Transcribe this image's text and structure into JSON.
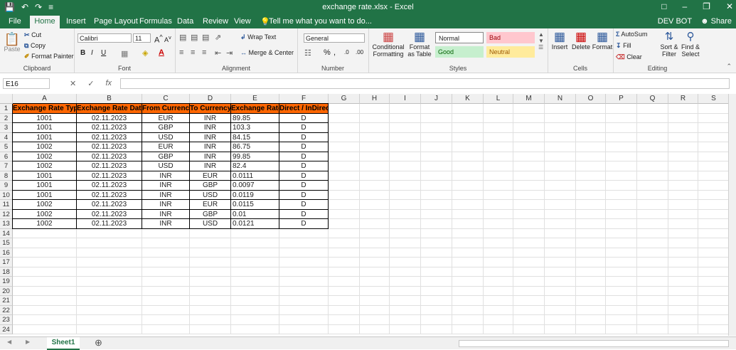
{
  "window": {
    "title": "exchange rate.xlsx - Excel",
    "user": "DEV BOT",
    "share": "Share"
  },
  "tabs": [
    "File",
    "Home",
    "Insert",
    "Page Layout",
    "Formulas",
    "Data",
    "Review",
    "View"
  ],
  "tell_me": "Tell me what you want to do...",
  "ribbon": {
    "clipboard": {
      "label": "Clipboard",
      "paste": "Paste",
      "cut": "Cut",
      "copy": "Copy",
      "format_painter": "Format Painter"
    },
    "font": {
      "label": "Font",
      "name": "Calibri",
      "size": "11"
    },
    "alignment": {
      "label": "Alignment",
      "wrap": "Wrap Text",
      "merge": "Merge & Center"
    },
    "number": {
      "label": "Number",
      "format": "General"
    },
    "styles": {
      "label": "Styles",
      "conditional": "Conditional Formatting",
      "format_as_table": "Format as Table",
      "normal": "Normal",
      "bad": "Bad",
      "good": "Good",
      "neutral": "Neutral"
    },
    "cells": {
      "label": "Cells",
      "insert": "Insert",
      "delete": "Delete",
      "format": "Format"
    },
    "editing": {
      "label": "Editing",
      "autosum": "AutoSum",
      "fill": "Fill",
      "clear": "Clear",
      "sort": "Sort & Filter",
      "find": "Find & Select"
    }
  },
  "formula_bar": {
    "name_box": "E16",
    "content": ""
  },
  "columns": [
    "A",
    "B",
    "C",
    "D",
    "E",
    "F",
    "G",
    "H",
    "I",
    "J",
    "K",
    "L",
    "M",
    "N",
    "O",
    "P",
    "Q",
    "R",
    "S"
  ],
  "rows": [
    "1",
    "2",
    "3",
    "4",
    "5",
    "6",
    "7",
    "8",
    "9",
    "10",
    "11",
    "12",
    "13",
    "14",
    "15",
    "16",
    "17",
    "18",
    "19",
    "20",
    "21",
    "22",
    "23",
    "24"
  ],
  "table": {
    "headers": [
      "Exchange Rate Type",
      "Exchange Rate Date",
      "From Currency",
      "To Currency",
      "Exchange Rate",
      "Direct / InDirect"
    ],
    "rows": [
      [
        "1001",
        "02.11.2023",
        "EUR",
        "INR",
        "89.85",
        "D"
      ],
      [
        "1001",
        "02.11.2023",
        "GBP",
        "INR",
        "103.3",
        "D"
      ],
      [
        "1001",
        "02.11.2023",
        "USD",
        "INR",
        "84.15",
        "D"
      ],
      [
        "1002",
        "02.11.2023",
        "EUR",
        "INR",
        "86.75",
        "D"
      ],
      [
        "1002",
        "02.11.2023",
        "GBP",
        "INR",
        "99.85",
        "D"
      ],
      [
        "1002",
        "02.11.2023",
        "USD",
        "INR",
        "82.4",
        "D"
      ],
      [
        "1001",
        "02.11.2023",
        "INR",
        "EUR",
        "0.0111",
        "D"
      ],
      [
        "1001",
        "02.11.2023",
        "INR",
        "GBP",
        "0.0097",
        "D"
      ],
      [
        "1001",
        "02.11.2023",
        "INR",
        "USD",
        "0.0119",
        "D"
      ],
      [
        "1002",
        "02.11.2023",
        "INR",
        "EUR",
        "0.0115",
        "D"
      ],
      [
        "1002",
        "02.11.2023",
        "INR",
        "GBP",
        "0.01",
        "D"
      ],
      [
        "1002",
        "02.11.2023",
        "INR",
        "USD",
        "0.0121",
        "D"
      ]
    ]
  },
  "sheet_tab": "Sheet1",
  "colors": {
    "excel_green": "#217346",
    "header_fill": "#ff6600"
  }
}
